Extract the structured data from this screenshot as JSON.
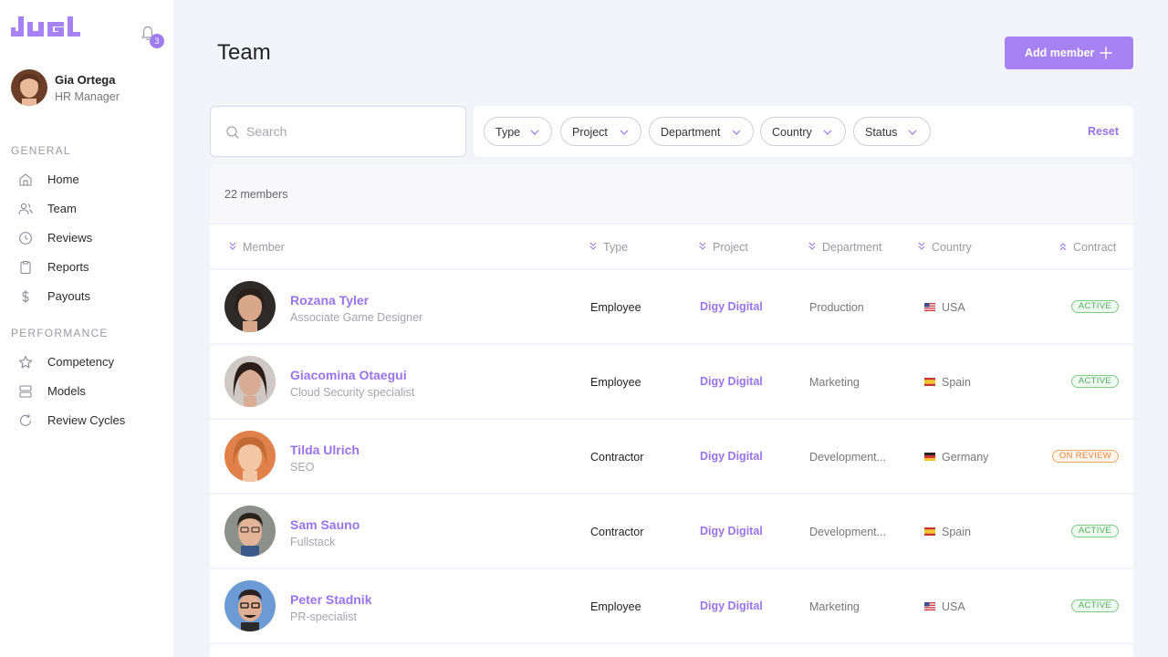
{
  "app": {
    "logo_text": "JUGL"
  },
  "notifications": {
    "count": "3"
  },
  "user": {
    "name": "Gia Ortega",
    "role": "HR Manager"
  },
  "sidebar": {
    "general_title": "GENERAL",
    "performance_title": "PERFORMANCE",
    "items": [
      {
        "label": "Home",
        "icon": "home-icon"
      },
      {
        "label": "Team",
        "icon": "users-icon"
      },
      {
        "label": "Reviews",
        "icon": "clock-icon"
      },
      {
        "label": "Reports",
        "icon": "clipboard-icon"
      },
      {
        "label": "Payouts",
        "icon": "dollar-icon"
      },
      {
        "label": "Competency",
        "icon": "star-icon"
      },
      {
        "label": "Models",
        "icon": "layers-icon"
      },
      {
        "label": "Review Cycles",
        "icon": "refresh-icon"
      }
    ]
  },
  "header": {
    "title": "Team",
    "add_label": "Add member"
  },
  "search": {
    "placeholder": "Search",
    "value": ""
  },
  "filters": {
    "chips": [
      "Type",
      "Project",
      "Department",
      "Country",
      "Status"
    ],
    "reset_label": "Reset"
  },
  "members_count": "22 members",
  "table": {
    "columns": [
      "Member",
      "Type",
      "Project",
      "Department",
      "Country",
      "Contract"
    ],
    "rows": [
      {
        "name": "Rozana Tyler",
        "role": "Associate Game Designer",
        "type": "Employee",
        "project": "Digy Digital",
        "department": "Production",
        "country": "USA",
        "flag": "usa",
        "status": "ACTIVE"
      },
      {
        "name": "Giacomina Otaegui",
        "role": "Cloud Security specialist",
        "type": "Employee",
        "project": "Digy Digital",
        "department": "Marketing",
        "country": "Spain",
        "flag": "spain",
        "status": "ACTIVE"
      },
      {
        "name": "Tilda Ulrich",
        "role": "SEO",
        "type": "Contractor",
        "project": "Digy Digital",
        "department": "Development...",
        "country": "Germany",
        "flag": "germany",
        "status": "ON REVIEW"
      },
      {
        "name": "Sam Sauno",
        "role": "Fullstack",
        "type": "Contractor",
        "project": "Digy Digital",
        "department": "Development...",
        "country": "Spain",
        "flag": "spain",
        "status": "ACTIVE"
      },
      {
        "name": "Peter Stadnik",
        "role": "PR-specialist",
        "type": "Employee",
        "project": "Digy Digital",
        "department": "Marketing",
        "country": "USA",
        "flag": "usa",
        "status": "ACTIVE"
      }
    ]
  },
  "colors": {
    "accent": "#a782f5",
    "link": "#9a73ea",
    "active": "#4fae5c",
    "review": "#e5873a"
  }
}
